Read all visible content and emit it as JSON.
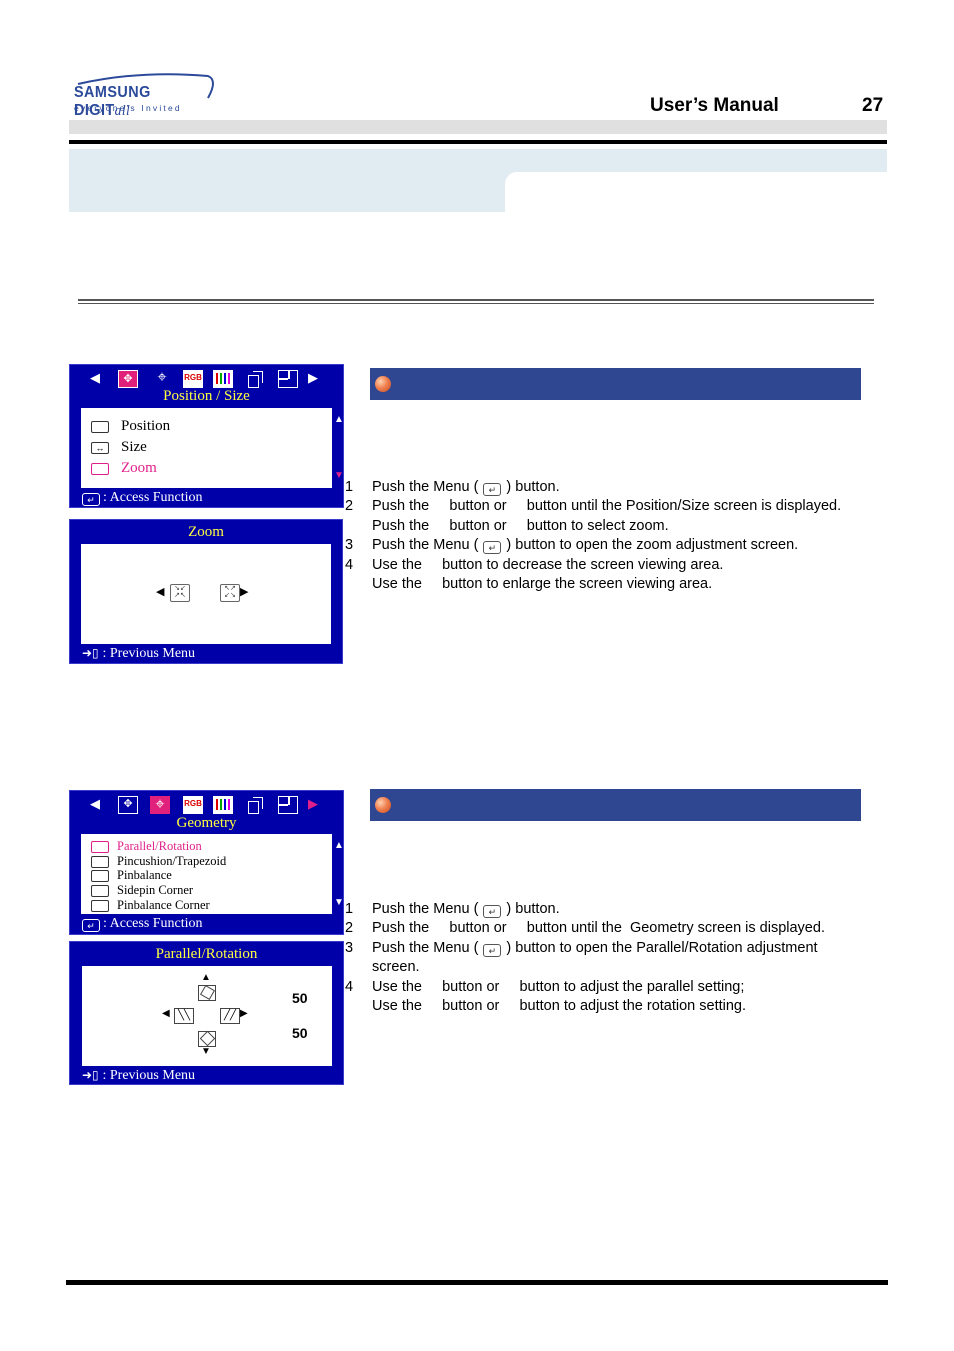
{
  "header": {
    "logo_brand": "SAMSUNG DIGIT",
    "logo_brand_suffix": "all",
    "logo_tagline": "everyone's Invited",
    "manual_title": "User’s Manual",
    "page_number": "27"
  },
  "section_zoom": {
    "osd_menu": {
      "icons": [
        "left-arrow",
        "position-size",
        "geometry",
        "rgb",
        "color-bars",
        "copy",
        "window",
        "right-arrow"
      ],
      "selected_icon": "position-size",
      "rgb_label": "RGB",
      "title": "Position / Size",
      "items": [
        {
          "label": "Position",
          "icon": "position-icon",
          "selected": false
        },
        {
          "label": "Size",
          "icon": "size-icon",
          "selected": false
        },
        {
          "label": "Zoom",
          "icon": "zoom-icon",
          "selected": true
        }
      ],
      "footer": ": Access Function"
    },
    "osd_adjust": {
      "title": "Zoom",
      "footer": ": Previous Menu"
    },
    "steps": [
      {
        "num": "1",
        "pre": "Push the Menu (",
        "post": ") button.",
        "has_enter": true
      },
      {
        "num": "2",
        "text": "Push the     button or     button until the Position/Size screen is displayed."
      },
      {
        "num": "",
        "text": "Push the     button or     button to select zoom."
      },
      {
        "num": "3",
        "pre": "Push the Menu (",
        "post": ") button to open the zoom adjustment screen.",
        "has_enter": true
      },
      {
        "num": "4",
        "text": "Use the     button to decrease the screen viewing area."
      },
      {
        "num": "",
        "text": "Use the     button to enlarge the screen viewing area."
      }
    ]
  },
  "section_geometry": {
    "osd_menu": {
      "icons": [
        "left-arrow",
        "position-size",
        "geometry",
        "rgb",
        "color-bars",
        "copy",
        "window",
        "right-arrow"
      ],
      "selected_icon": "geometry",
      "rgb_label": "RGB",
      "title": "Geometry",
      "items": [
        {
          "label": "Parallel/Rotation",
          "icon": "parallel-icon",
          "selected": true
        },
        {
          "label": "Pincushion/Trapezoid",
          "icon": "pincushion-icon",
          "selected": false
        },
        {
          "label": "Pinbalance",
          "icon": "pinbalance-icon",
          "selected": false
        },
        {
          "label": "Sidepin Corner",
          "icon": "sidepin-icon",
          "selected": false
        },
        {
          "label": "Pinbalance Corner",
          "icon": "pinbalance-corner-icon",
          "selected": false
        }
      ],
      "footer": ": Access Function"
    },
    "osd_adjust": {
      "title": "Parallel/Rotation",
      "rotation_value": "50",
      "parallel_value": "50",
      "footer": ": Previous Menu"
    },
    "steps": [
      {
        "num": "1",
        "pre": "Push the Menu (",
        "post": ") button.",
        "has_enter": true
      },
      {
        "num": "2",
        "text": "Push the     button or     button until the  Geometry screen is displayed."
      },
      {
        "num": "3",
        "pre": "Push the Menu (",
        "post": ") button to open the Parallel/Rotation adjustment",
        "has_enter": true
      },
      {
        "num": "",
        "text": "screen."
      },
      {
        "num": "4",
        "text": "Use the     button or     button to adjust the parallel setting;"
      },
      {
        "num": "",
        "text": "Use the     button or     button to adjust the rotation setting."
      }
    ]
  },
  "colors": {
    "osd_blue": "#0000a8",
    "osd_title_yellow": "#ffff40",
    "selected_pink": "#e0208a",
    "section_bar": "#2f4691",
    "header_band": "#e0ebf2"
  }
}
